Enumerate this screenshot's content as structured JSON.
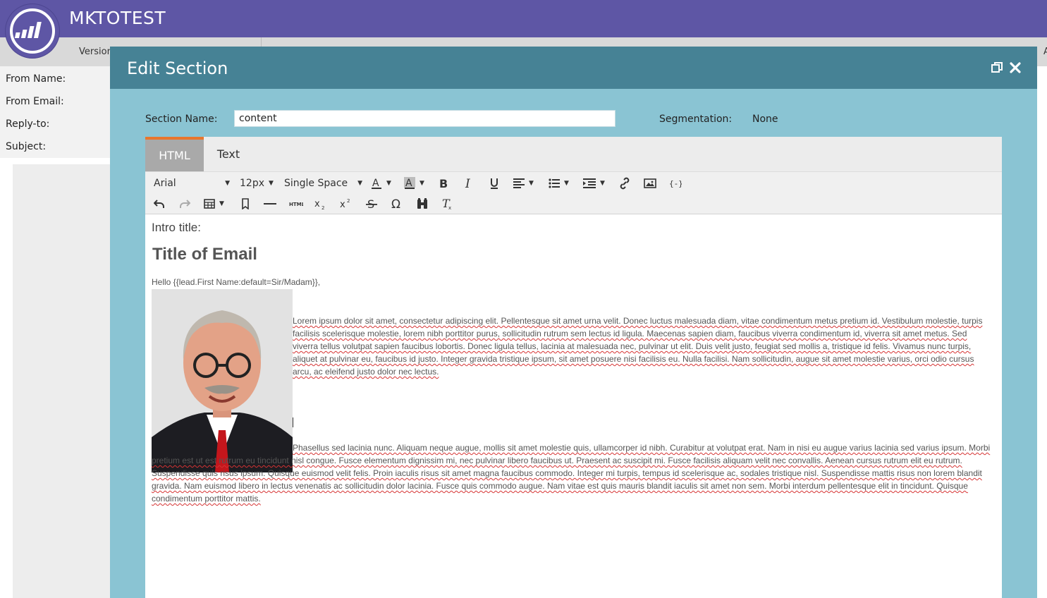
{
  "app": {
    "title": "MKTOTEST"
  },
  "subbar": {
    "version_label": "Version",
    "right_label": "A"
  },
  "email_form": {
    "from_name_label": "From Name:",
    "from_email_label": "From Email:",
    "reply_to_label": "Reply-to:",
    "subject_label": "Subject:"
  },
  "modal": {
    "title": "Edit Section",
    "section_name_label": "Section Name:",
    "section_name_value": "content",
    "segmentation_label": "Segmentation:",
    "segmentation_value": "None"
  },
  "tabs": [
    {
      "label": "HTML",
      "active": true
    },
    {
      "label": "Text",
      "active": false
    }
  ],
  "toolbar": {
    "font_family": "Arial",
    "font_size": "12px",
    "line_spacing": "Single Space"
  },
  "content": {
    "intro": "Intro title:",
    "title": "Title of Email",
    "hello": "Hello {{lead.First Name:default=Sir/Madam}},",
    "para1": "Lorem ipsum dolor sit amet, consectetur adipiscing elit. Pellentesque sit amet urna velit. Donec luctus malesuada diam, vitae condimentum metus pretium id. Vestibulum molestie, turpis facilisis scelerisque molestie, lorem nibh porttitor purus, sollicitudin rutrum sem lectus id ligula. Maecenas sapien diam, faucibus viverra condimentum id, viverra sit amet metus. Sed viverra tellus volutpat sapien faucibus lobortis. Donec ligula tellus, lacinia at malesuada nec, pulvinar ut elit. Duis velit justo, feugiat sed mollis a, tristique id felis. Vivamus nunc turpis, aliquet at pulvinar eu, faucibus id justo. Integer gravida tristique ipsum, sit amet posuere nisi facilisis eu. Nulla facilisi. Nam sollicitudin, augue sit amet molestie varius, orci odio cursus arcu, ac eleifend justo dolor nec lectus.",
    "para2": "Phasellus sed lacinia nunc. Aliquam neque augue, mollis sit amet molestie quis, ullamcorper id nibh. Curabitur at volutpat erat. Nam in nisi eu augue varius lacinia sed varius ipsum. Morbi pretium est ut est rutrum eu tincidunt nisl congue. Fusce elementum dignissim mi, nec pulvinar libero faucibus ut. Praesent ac suscipit mi. Fusce facilisis aliquam velit nec convallis. Aenean cursus rutrum elit eu rutrum. Suspendisse quis risus ipsum. Quisque euismod velit felis. Proin iaculis risus sit amet magna faucibus commodo. Integer mi turpis, tempus id scelerisque ac, sodales tristique nisl. Suspendisse mattis risus non lorem blandit gravida. Nam euismod libero in lectus venenatis ac sollicitudin dolor lacinia. Fusce quis commodo augue. Nam vitae est quis mauris blandit iaculis sit amet non sem. Morbi interdum pellentesque elit in tincidunt. Quisque condimentum porttitor mattis."
  },
  "colors": {
    "header": "#5e56a5",
    "modal_header": "#468295",
    "modal_body": "#8ac4d3",
    "active_tab_accent": "#e8762d"
  },
  "icons": [
    "marketo-logo-icon",
    "restore-window-icon",
    "close-icon",
    "font-color-icon",
    "highlight-color-icon",
    "bold-icon",
    "italic-icon",
    "underline-icon",
    "align-icon",
    "bullet-list-icon",
    "indent-icon",
    "link-icon",
    "image-icon",
    "token-icon",
    "undo-icon",
    "redo-icon",
    "table-icon",
    "bookmark-icon",
    "horizontal-rule-icon",
    "html-source-icon",
    "subscript-icon",
    "superscript-icon",
    "strikethrough-icon",
    "special-char-icon",
    "find-icon",
    "clear-format-icon"
  ]
}
